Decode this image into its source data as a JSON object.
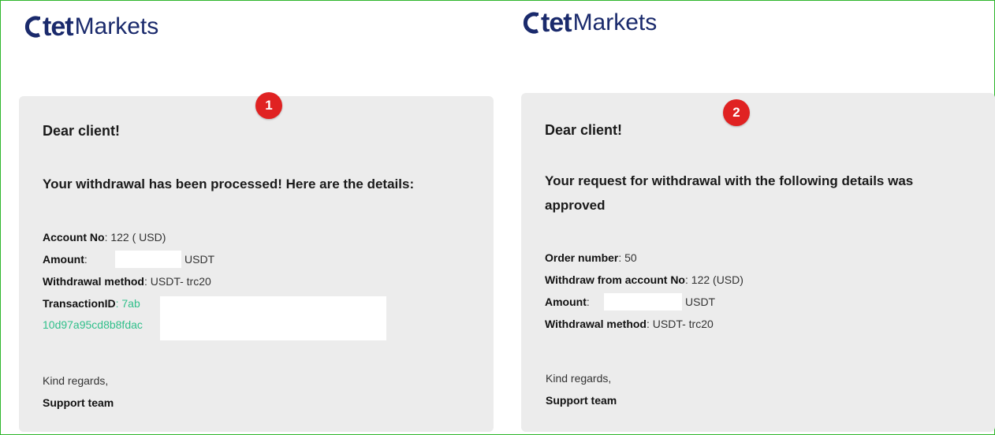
{
  "brand": {
    "logo_bold": "tet",
    "logo_light": "Markets",
    "colors": {
      "brand_navy": "#1a2a6c",
      "accent_green": "#2fbf8a",
      "badge_red": "#e02222",
      "frame_green": "#2eb62c"
    }
  },
  "email1": {
    "badge": "1",
    "greeting": "Dear client!",
    "headline": "Your withdrawal has been processed! Here are the details:",
    "account_label": "Account No",
    "account_value": ": 122 ( USD)",
    "amount_label": "Amount",
    "amount_suffix": "USDT",
    "method_label": "Withdrawal method",
    "method_value": ": USDT- trc20",
    "txid_label": "TransactionID",
    "txid_prefix": ": 7ab",
    "txid_line2": "10d97a95cd8b8fdac",
    "regards": "Kind regards,",
    "team": "Support team"
  },
  "email2": {
    "badge": "2",
    "greeting": "Dear client!",
    "headline_line1": "Your request for withdrawal with the following details was",
    "headline_line2": "approved",
    "order_label": "Order number",
    "order_value": ": 50",
    "from_label": "Withdraw from account No",
    "from_value": ": 122 (USD)",
    "amount_label": "Amount",
    "amount_suffix": "USDT",
    "method_label": "Withdrawal method",
    "method_value": ": USDT- trc20",
    "regards": "Kind regards,",
    "team": "Support team"
  }
}
